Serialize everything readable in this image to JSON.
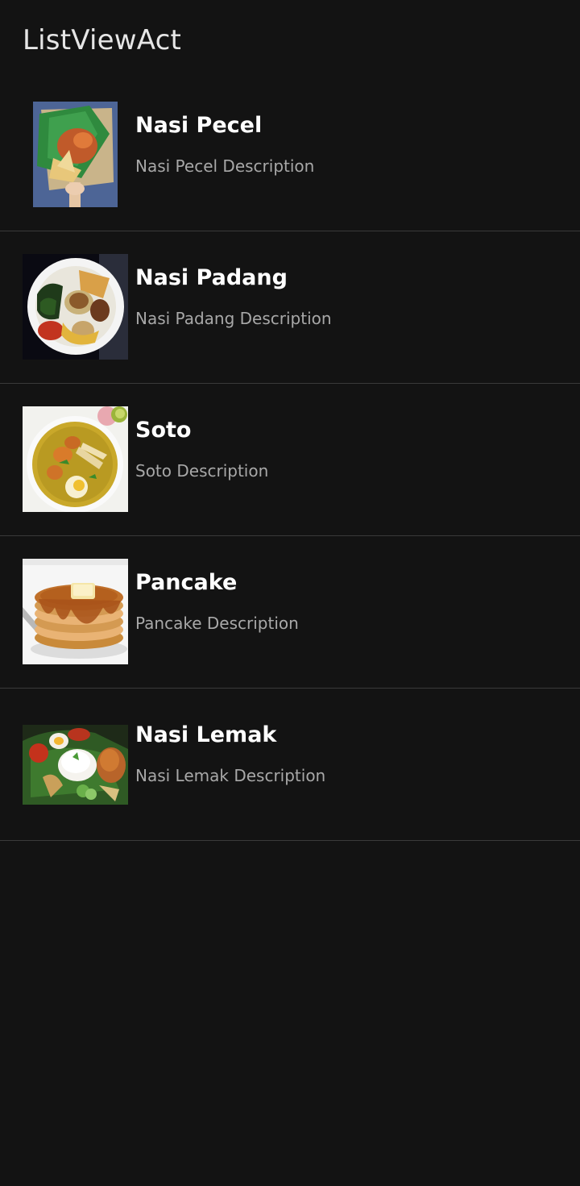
{
  "app": {
    "title": "ListViewAct"
  },
  "list": {
    "items": [
      {
        "title": "Nasi Pecel",
        "description": "Nasi Pecel Description",
        "image": "nasi-pecel-photo"
      },
      {
        "title": "Nasi Padang",
        "description": "Nasi Padang Description",
        "image": "nasi-padang-photo"
      },
      {
        "title": "Soto",
        "description": "Soto Description",
        "image": "soto-photo"
      },
      {
        "title": "Pancake",
        "description": "Pancake Description",
        "image": "pancake-photo"
      },
      {
        "title": "Nasi Lemak",
        "description": "Nasi Lemak Description",
        "image": "nasi-lemak-photo"
      }
    ]
  },
  "colors": {
    "background": "#131313",
    "divider": "#3a3a3a",
    "title_text": "#ffffff",
    "description_text": "#a8a8a8",
    "app_title_text": "#e6e6e6"
  }
}
